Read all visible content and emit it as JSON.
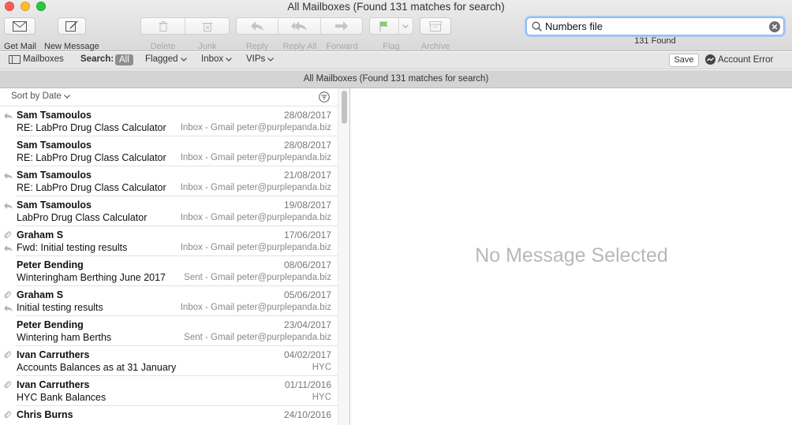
{
  "window": {
    "title": "All Mailboxes (Found 131 matches for search)"
  },
  "toolbar": {
    "get_mail": "Get Mail",
    "new_message": "New Message",
    "delete": "Delete",
    "junk": "Junk",
    "reply": "Reply",
    "reply_all": "Reply All",
    "forward": "Forward",
    "flag": "Flag",
    "archive": "Archive"
  },
  "search": {
    "value": "Numbers file",
    "found": "131 Found"
  },
  "scopebar": {
    "mailboxes": "Mailboxes",
    "search_label": "Search:",
    "all": "All",
    "flagged": "Flagged",
    "inbox": "Inbox",
    "vips": "VIPs",
    "save": "Save",
    "account_error": "Account Error"
  },
  "infobar": {
    "text": "All Mailboxes (Found 131 matches for search)"
  },
  "list": {
    "sort_label": "Sort by Date",
    "messages": [
      {
        "from": "Sam Tsamoulos",
        "date": "28/08/2017",
        "subject": "RE: LabPro Drug Class Calculator",
        "mailbox": "Inbox - Gmail peter@purplepanda.biz",
        "replied": true,
        "attachment": false
      },
      {
        "from": "Sam Tsamoulos",
        "date": "28/08/2017",
        "subject": "RE: LabPro Drug Class Calculator",
        "mailbox": "Inbox - Gmail peter@purplepanda.biz",
        "replied": false,
        "attachment": false
      },
      {
        "from": "Sam Tsamoulos",
        "date": "21/08/2017",
        "subject": "RE: LabPro Drug Class Calculator",
        "mailbox": "Inbox - Gmail peter@purplepanda.biz",
        "replied": true,
        "attachment": false
      },
      {
        "from": "Sam Tsamoulos",
        "date": "19/08/2017",
        "subject": "LabPro Drug Class Calculator",
        "mailbox": "Inbox - Gmail peter@purplepanda.biz",
        "replied": true,
        "attachment": false
      },
      {
        "from": "Graham S",
        "date": "17/06/2017",
        "subject": "Fwd: Initial testing results",
        "mailbox": "Inbox - Gmail peter@purplepanda.biz",
        "replied": true,
        "attachment": true
      },
      {
        "from": "Peter Bending",
        "date": "08/06/2017",
        "subject": "Winteringham Berthing June 2017",
        "mailbox": "Sent - Gmail peter@purplepanda.biz",
        "replied": false,
        "attachment": false
      },
      {
        "from": "Graham S",
        "date": "05/06/2017",
        "subject": "Initial testing results",
        "mailbox": "Inbox - Gmail peter@purplepanda.biz",
        "replied": true,
        "attachment": true
      },
      {
        "from": "Peter Bending",
        "date": "23/04/2017",
        "subject": "Wintering ham Berths",
        "mailbox": "Sent - Gmail peter@purplepanda.biz",
        "replied": false,
        "attachment": false
      },
      {
        "from": "Ivan Carruthers",
        "date": "04/02/2017",
        "subject": "Accounts Balances as at 31 January",
        "mailbox": "HYC",
        "replied": false,
        "attachment": true
      },
      {
        "from": "Ivan Carruthers",
        "date": "01/11/2016",
        "subject": "HYC Bank Balances",
        "mailbox": "HYC",
        "replied": false,
        "attachment": true
      },
      {
        "from": "Chris Burns",
        "date": "24/10/2016",
        "subject": "",
        "mailbox": "",
        "replied": false,
        "attachment": true
      }
    ]
  },
  "preview": {
    "empty_text": "No Message Selected"
  },
  "colors": {
    "accent": "#8bb4ee",
    "flag_green": "#7ed06a",
    "all_pill": "#8e8e8e"
  }
}
